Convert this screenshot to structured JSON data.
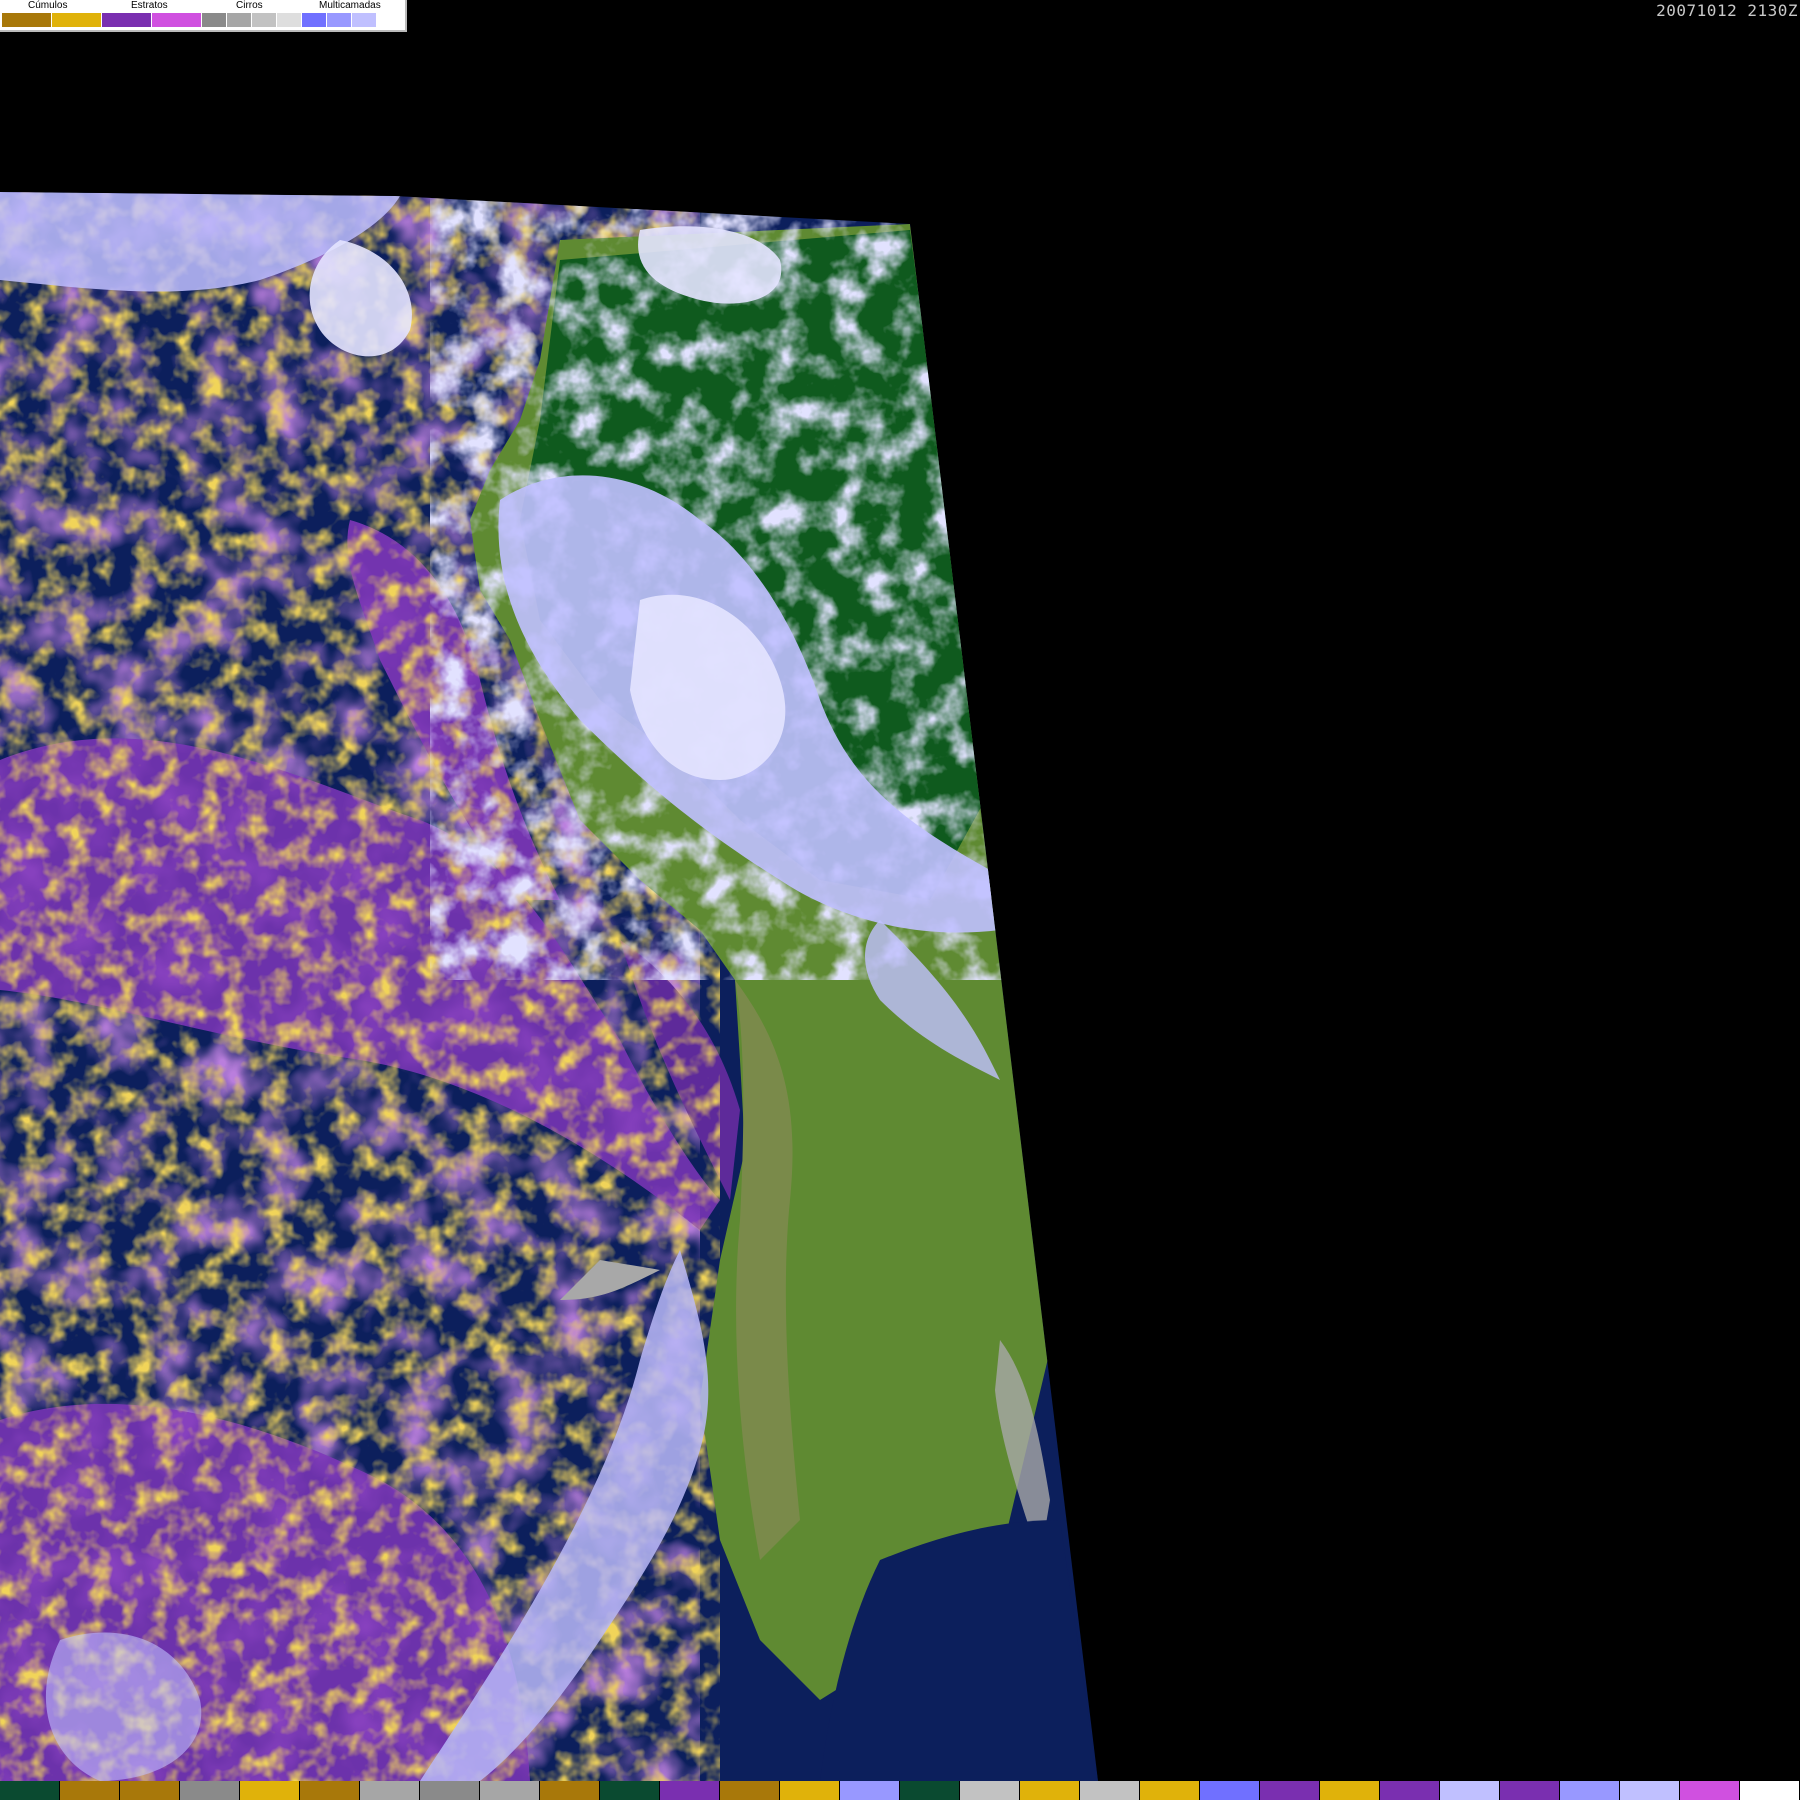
{
  "legend": {
    "groups": [
      {
        "label": "Cúmulos"
      },
      {
        "label": "Estratos"
      },
      {
        "label": "Cirros"
      },
      {
        "label": "Multicamadas"
      }
    ],
    "swatch_colors": [
      "#a8780a",
      "#e0b20a",
      "#7a2fb0",
      "#d050e0",
      "#8a8a8a",
      "#a6a6a6",
      "#c2c2c2",
      "#dedede",
      "#7070ff",
      "#9898ff",
      "#c0c0ff",
      "#ffffff"
    ]
  },
  "timestamp": "20071012 2130Z",
  "map": {
    "colors": {
      "ocean": "#0c1f5c",
      "stratus": "#7e36b8",
      "cumulus": "#e0a818",
      "cumulus_dark": "#a8780a",
      "multilayer": "#b8b8f8",
      "multilayer_bright": "#e4e4ff",
      "cirrus": "#a8a8a8",
      "forest": "#0f5a1e",
      "land": "#5f8a32",
      "land_dry": "#7a8a4a"
    }
  },
  "bottom_strip": {
    "colors": [
      "#0a4a30",
      "#a8780a",
      "#a8780a",
      "#8a8a8a",
      "#e0b20a",
      "#a8780a",
      "#a6a6a6",
      "#8a8a8a",
      "#a6a6a6",
      "#a8780a",
      "#0a4a30",
      "#7a2fb0",
      "#a8780a",
      "#e0b20a",
      "#9898ff",
      "#0a4a30",
      "#c2c2c2",
      "#e0b20a",
      "#c2c2c2",
      "#e0b20a",
      "#7070ff",
      "#7a2fb0",
      "#e0b20a",
      "#7a2fb0",
      "#c0c0ff",
      "#7a2fb0",
      "#9898ff",
      "#c0c0ff",
      "#d050e0",
      "#ffffff"
    ]
  }
}
